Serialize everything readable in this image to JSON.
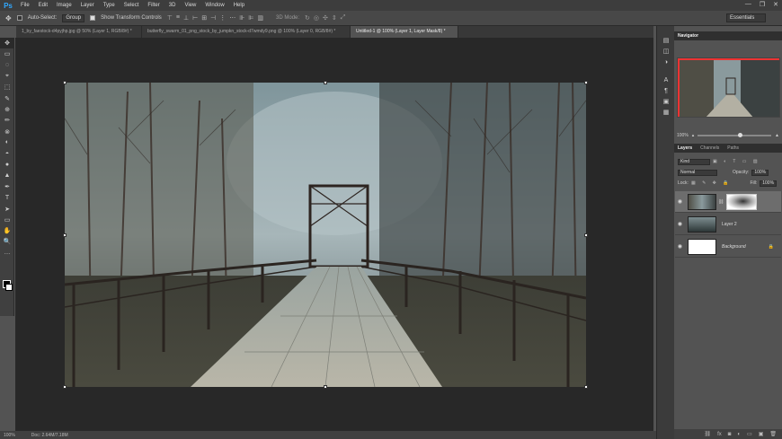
{
  "app": {
    "logo": "Ps"
  },
  "menu": [
    "File",
    "Edit",
    "Image",
    "Layer",
    "Type",
    "Select",
    "Filter",
    "3D",
    "View",
    "Window",
    "Help"
  ],
  "window_controls": [
    "—",
    "❐",
    "✕"
  ],
  "options": {
    "move_icon": "move-tool-icon",
    "auto_select_label": "Auto-Select:",
    "auto_select_value": "Group",
    "show_transform_label": "Show Transform Controls",
    "mode_3d_label": "3D Mode:",
    "workspace": "Essentials"
  },
  "tabs": [
    {
      "label": "1_by_faestock-d4pyjhp.jpg @ 50% (Layer 1, RGB/8#) *",
      "active": false
    },
    {
      "label": "butterfly_swarm_01_png_stock_by_jumpkn_stock-d7wmdy9.png @ 100% (Layer 0, RGB/8#) *",
      "active": false
    },
    {
      "label": "Untitled-1 @ 100% (Layer 1, Layer Mask/8) *",
      "active": true
    }
  ],
  "tools": [
    "✥",
    "▭",
    "◌",
    "⌖",
    "⬚",
    "✎",
    "⊕",
    "✏",
    "⊗",
    "◐",
    "◓",
    "●",
    "▲",
    "✒",
    "T",
    "➤",
    "▭",
    "✋",
    "🔍",
    "…"
  ],
  "status": {
    "zoom": "100%",
    "doc": "Doc: 2.64M/7.18M"
  },
  "navigator": {
    "tabs": [
      "Navigator"
    ],
    "zoom": "100%"
  },
  "layers": {
    "tabs": [
      "Layers",
      "Channels",
      "Paths"
    ],
    "kind": "Kind",
    "blend": "Normal",
    "opacity_label": "Opacity:",
    "opacity": "100%",
    "lock_label": "Lock:",
    "fill_label": "Fill:",
    "fill": "100%",
    "items": [
      {
        "name": "",
        "selected": true,
        "mask": true
      },
      {
        "name": "Layer 2",
        "selected": false,
        "mask": false
      },
      {
        "name": "Background",
        "selected": false,
        "mask": false,
        "locked": true
      }
    ],
    "footer": [
      "⛓",
      "fx",
      "◙",
      "◐",
      "▭",
      "▣",
      "🗑"
    ]
  },
  "colors": {
    "accent": "#31a8ff",
    "navigator_box": "#e33333"
  }
}
